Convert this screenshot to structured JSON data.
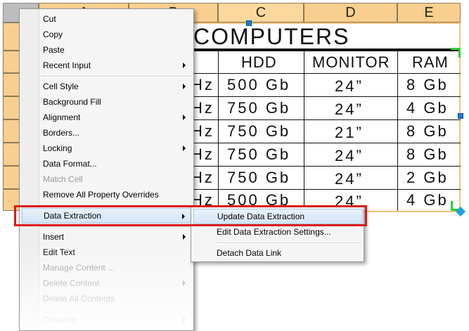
{
  "sheet": {
    "columns": [
      "A",
      "B",
      "C",
      "D",
      "E"
    ],
    "table_title": "COMPUTERS",
    "headers": [
      "HDD",
      "MONITOR",
      "RAM"
    ],
    "rows": [
      {
        "cpu_tail": "Hz",
        "hdd": "500 Gb",
        "monitor": "24”",
        "ram": "8 Gb"
      },
      {
        "cpu_tail": "Hz",
        "hdd": "750 Gb",
        "monitor": "24”",
        "ram": "4 Gb"
      },
      {
        "cpu_tail": "Hz",
        "hdd": "750 Gb",
        "monitor": "21”",
        "ram": "8 Gb"
      },
      {
        "cpu_tail": "Hz",
        "hdd": "750 Gb",
        "monitor": "24”",
        "ram": "8 Gb"
      },
      {
        "cpu_tail": "Hz",
        "hdd": "750 Gb",
        "monitor": "24”",
        "ram": "2 Gb"
      },
      {
        "cpu_tail": "Hz",
        "hdd": "500 Gb",
        "monitor": "24”",
        "ram": "4 Gb"
      }
    ]
  },
  "context_menu": {
    "items": [
      {
        "label": "Cut"
      },
      {
        "label": "Copy"
      },
      {
        "label": "Paste"
      },
      {
        "label": "Recent Input"
      },
      {
        "label": "Cell Style"
      },
      {
        "label": "Background Fill"
      },
      {
        "label": "Alignment"
      },
      {
        "label": "Borders..."
      },
      {
        "label": "Locking"
      },
      {
        "label": "Data Format..."
      },
      {
        "label": "Match Cell"
      },
      {
        "label": "Remove All Property Overrides"
      },
      {
        "label": "Data Extraction"
      },
      {
        "label": "Insert"
      },
      {
        "label": "Edit Text"
      },
      {
        "label": "Manage Content ..."
      },
      {
        "label": "Delete Content"
      },
      {
        "label": "Delete All Contents"
      },
      {
        "label": "Columns"
      }
    ]
  },
  "submenu": {
    "items": [
      {
        "label": "Update Data Extraction"
      },
      {
        "label": "Edit Data Extraction Settings..."
      },
      {
        "label": "Detach Data Link"
      }
    ]
  },
  "colors": {
    "header_fill": "#f9cf90",
    "highlight_border": "#d81a1a",
    "grip_blue": "#1e7ad8",
    "grip_green": "#2fd02f"
  }
}
